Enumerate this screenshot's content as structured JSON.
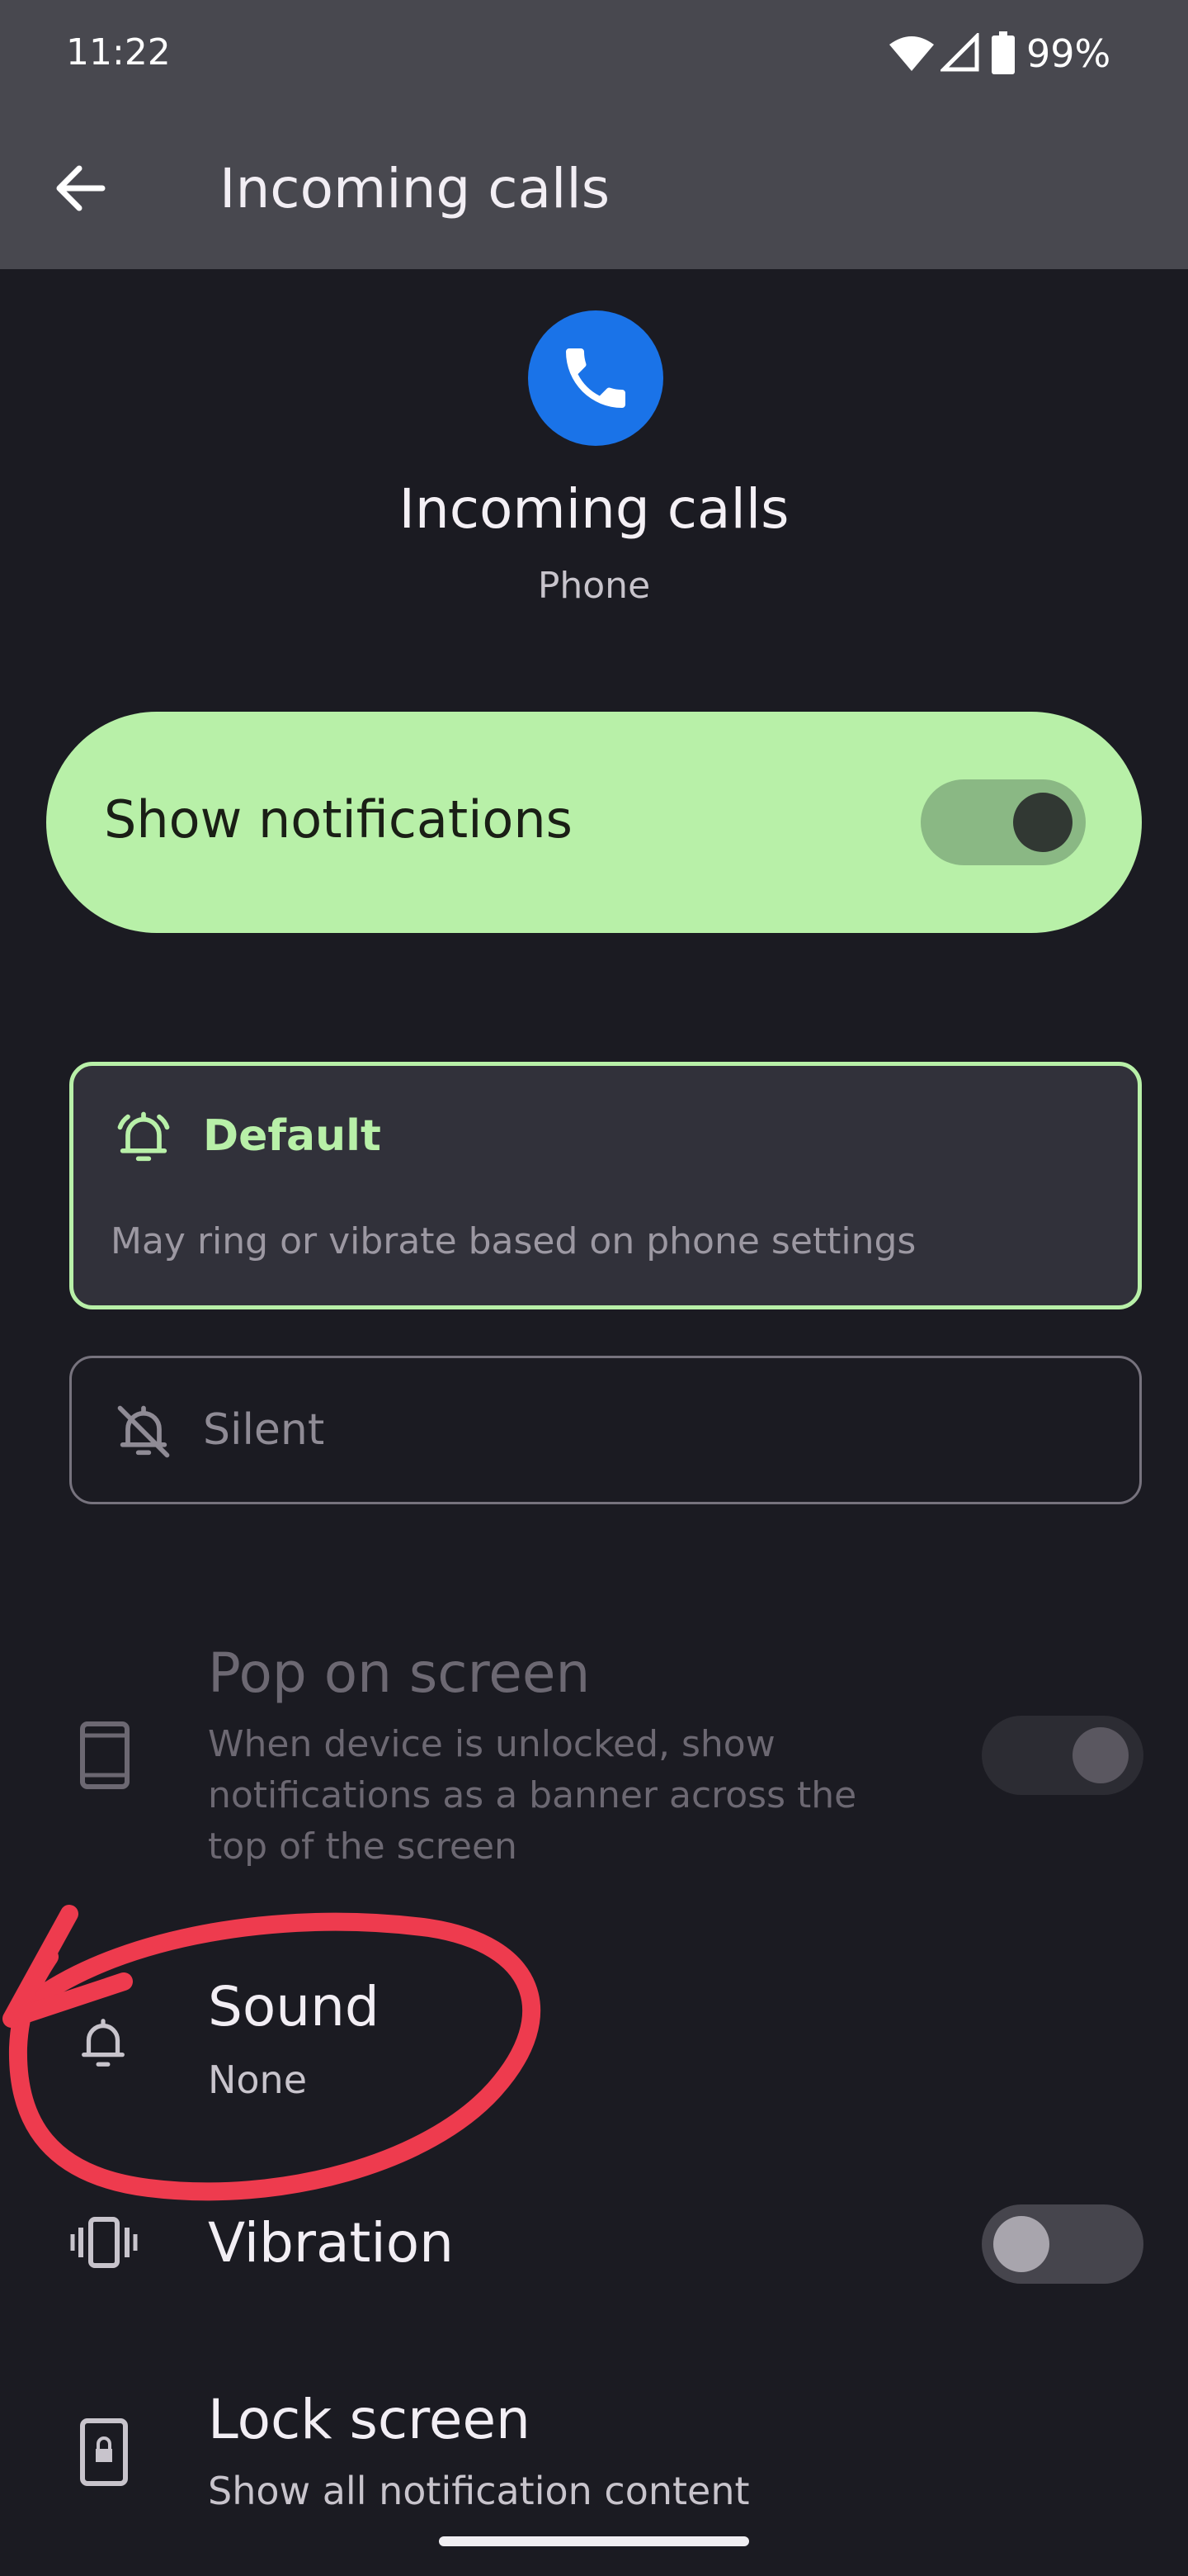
{
  "status_bar": {
    "time": "11:22",
    "battery": "99%"
  },
  "app_bar": {
    "title": "Incoming calls"
  },
  "channel": {
    "title": "Incoming calls",
    "app_name": "Phone"
  },
  "show_notifications": {
    "label": "Show notifications",
    "enabled": true
  },
  "alert_options": {
    "default": {
      "label": "Default",
      "description": "May ring or vibrate based on phone settings",
      "selected": true
    },
    "silent": {
      "label": "Silent",
      "selected": false
    }
  },
  "settings": {
    "pop_on_screen": {
      "title": "Pop on screen",
      "description_lines": [
        "When device is unlocked, show",
        "notifications as a banner across the",
        "top of the screen"
      ],
      "enabled": true,
      "disabled_state": true
    },
    "sound": {
      "title": "Sound",
      "value": "None"
    },
    "vibration": {
      "title": "Vibration",
      "enabled": false
    },
    "lock_screen": {
      "title": "Lock screen",
      "value": "Show all notification content"
    }
  },
  "colors": {
    "accent_green": "#b8f0a8",
    "background": "#1b1b22",
    "app_bar": "#48484f",
    "phone_icon_blue": "#1a73e8",
    "annotation_red": "#ee3b4e"
  },
  "icons": [
    "back-arrow-icon",
    "phone-icon",
    "wifi-icon",
    "signal-icon",
    "battery-icon",
    "bell-ring-icon",
    "bell-off-icon",
    "phone-device-icon",
    "bell-icon",
    "vibration-icon",
    "lock-screen-icon"
  ]
}
